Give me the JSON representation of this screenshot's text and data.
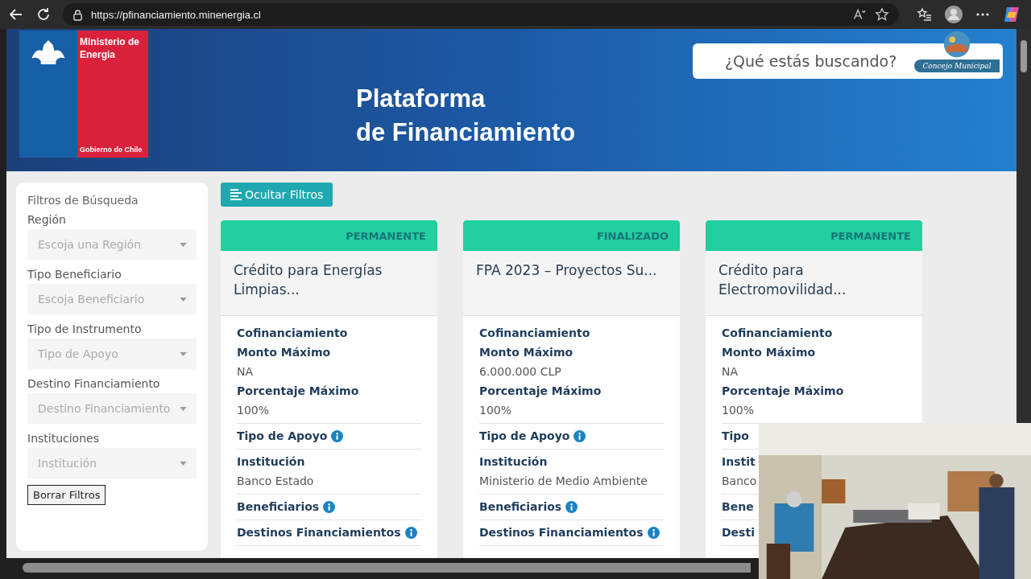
{
  "browser": {
    "url": "https://pfinanciamiento.minenergia.cl"
  },
  "header": {
    "ministry": "Ministerio de Energia",
    "government": "Gobierno de Chile",
    "title_lines": [
      "Plataforma",
      "de Financiamiento"
    ],
    "search": {
      "placeholder": "¿Qué estás buscando?"
    }
  },
  "overlay_logo": {
    "text": "Concejo Municipal"
  },
  "filters": {
    "title": "Filtros de Búsqueda",
    "groups": [
      {
        "label": "Región",
        "placeholder": "Escoja una Región"
      },
      {
        "label": "Tipo Beneficiario",
        "placeholder": "Escoja Beneficiario"
      },
      {
        "label": "Tipo de Instrumento",
        "placeholder": "Tipo de Apoyo"
      },
      {
        "label": "Destino Financiamiento",
        "placeholder": "Destino Financiamiento"
      },
      {
        "label": "Instituciones",
        "placeholder": "Institución"
      }
    ],
    "clear_button": "Borrar Filtros"
  },
  "toggle_button": "Ocultar Filtros",
  "cards": [
    {
      "status": "PERMANENTE",
      "title": "Crédito para Energías Limpias...",
      "sections": [
        [
          {
            "kind": "label",
            "text": "Cofinanciamiento"
          },
          {
            "kind": "label",
            "text": "Monto Máximo"
          },
          {
            "kind": "value",
            "text": "NA"
          },
          {
            "kind": "label",
            "text": "Porcentaje Máximo"
          },
          {
            "kind": "value",
            "text": "100%"
          }
        ],
        [
          {
            "kind": "info",
            "text": "Tipo de Apoyo"
          }
        ],
        [
          {
            "kind": "label",
            "text": "Institución"
          },
          {
            "kind": "value",
            "text": "Banco Estado"
          }
        ],
        [
          {
            "kind": "info",
            "text": "Beneficiarios"
          }
        ],
        [
          {
            "kind": "info",
            "text": "Destinos Financiamientos"
          }
        ]
      ]
    },
    {
      "status": "FINALIZADO",
      "title": "FPA 2023 – Proyectos Su...",
      "sections": [
        [
          {
            "kind": "label",
            "text": "Cofinanciamiento"
          },
          {
            "kind": "label",
            "text": "Monto Máximo"
          },
          {
            "kind": "value",
            "text": "6.000.000 CLP"
          },
          {
            "kind": "label",
            "text": "Porcentaje Máximo"
          },
          {
            "kind": "value",
            "text": "100%"
          }
        ],
        [
          {
            "kind": "info",
            "text": "Tipo de Apoyo"
          }
        ],
        [
          {
            "kind": "label",
            "text": "Institución"
          },
          {
            "kind": "value",
            "text": "Ministerio de Medio Ambiente"
          }
        ],
        [
          {
            "kind": "info",
            "text": "Beneficiarios"
          }
        ],
        [
          {
            "kind": "info",
            "text": "Destinos Financiamientos"
          }
        ]
      ]
    },
    {
      "status": "PERMANENTE",
      "title": "Crédito para Electromovilidad...",
      "sections": [
        [
          {
            "kind": "label",
            "text": "Cofinanciamiento"
          },
          {
            "kind": "label",
            "text": "Monto Máximo"
          },
          {
            "kind": "value",
            "text": "NA"
          },
          {
            "kind": "label",
            "text": "Porcentaje Máximo"
          },
          {
            "kind": "value",
            "text": "100%"
          }
        ],
        [
          {
            "kind": "label",
            "text": "Tipo"
          }
        ],
        [
          {
            "kind": "label",
            "text": "Instit"
          },
          {
            "kind": "value",
            "text": "Banco"
          }
        ],
        [
          {
            "kind": "label",
            "text": "Bene"
          }
        ],
        [
          {
            "kind": "label",
            "text": "Desti"
          }
        ]
      ]
    }
  ]
}
